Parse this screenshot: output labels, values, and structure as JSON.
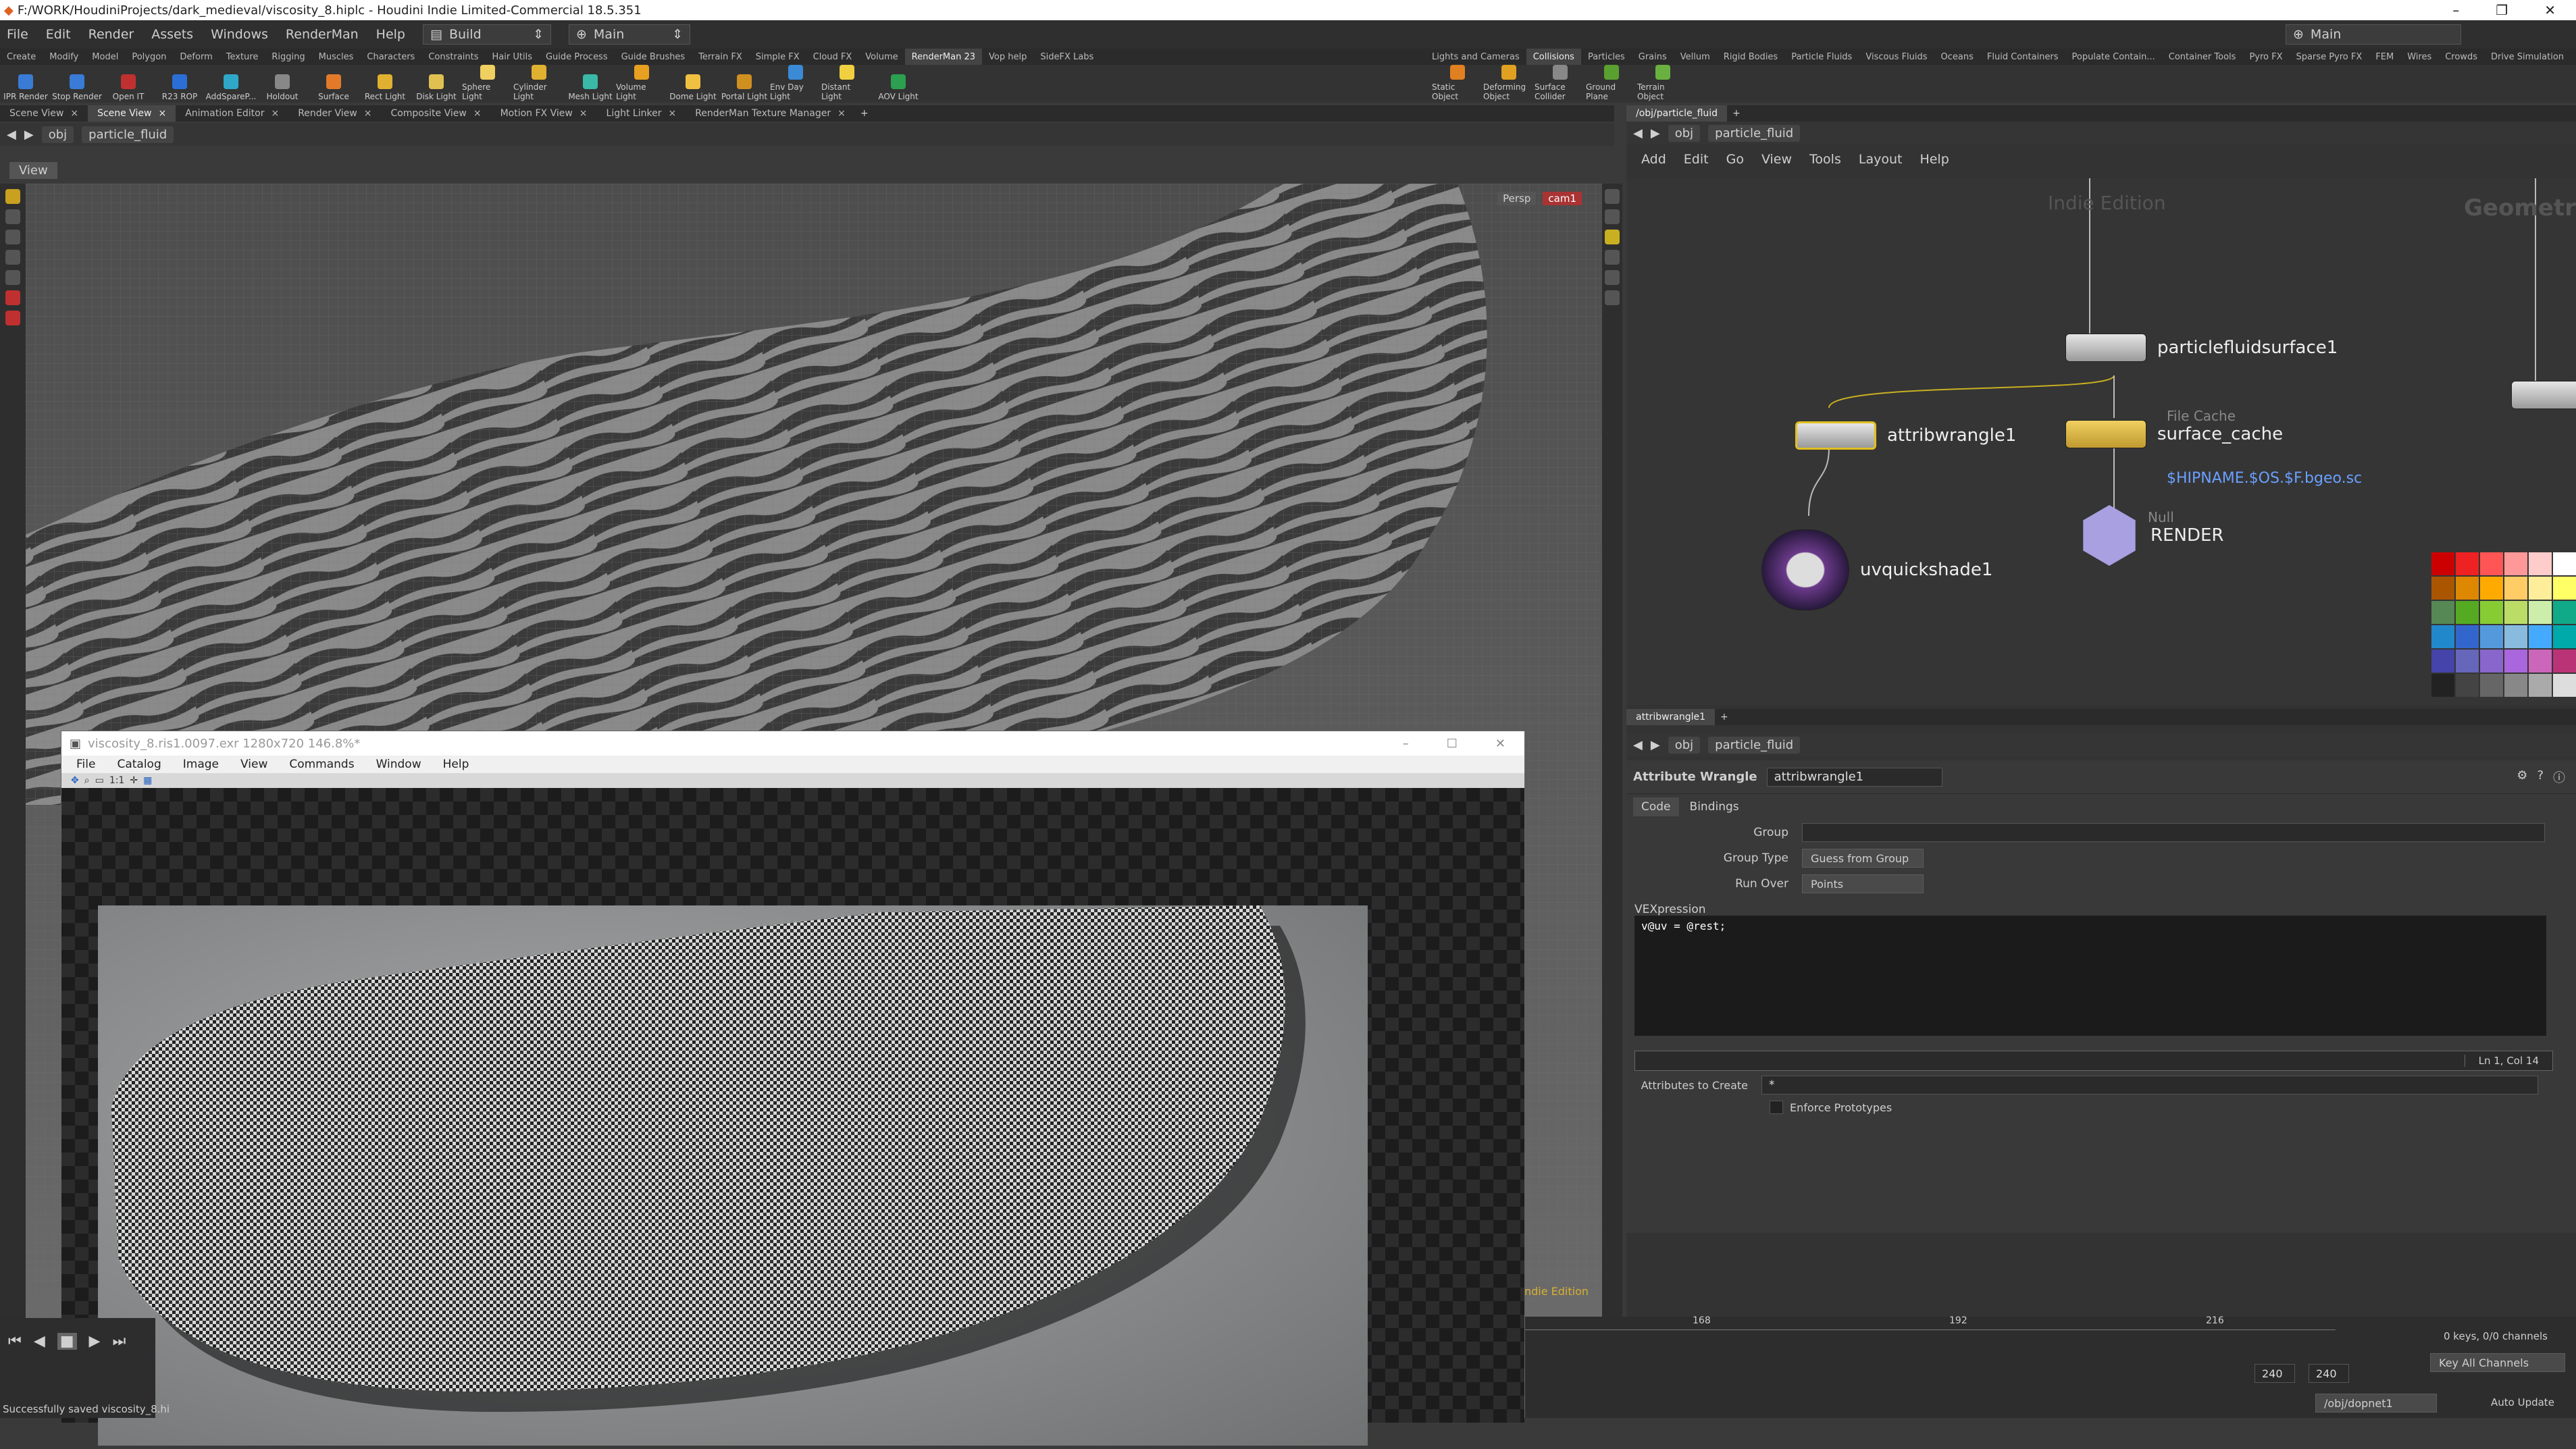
{
  "window": {
    "title": "F:/WORK/HoudiniProjects/dark_medieval/viscosity_8.hiplc - Houdini Indie Limited-Commercial 18.5.351",
    "controls": [
      "–",
      "❐",
      "✕"
    ]
  },
  "menubar": {
    "items": [
      "File",
      "Edit",
      "Render",
      "Assets",
      "Windows",
      "RenderMan",
      "Help"
    ],
    "desktop": "Build",
    "context": "Main",
    "right_context": "Main"
  },
  "shelf_tabs_left": [
    "Create",
    "Modify",
    "Model",
    "Polygon",
    "Deform",
    "Texture",
    "Rigging",
    "Muscles",
    "Characters",
    "Constraints",
    "Hair Utils",
    "Guide Process",
    "Guide Brushes",
    "Terrain FX",
    "Simple FX",
    "Cloud FX",
    "Volume",
    "RenderMan 23",
    "Vop help",
    "SideFX Labs"
  ],
  "shelf_tabs_left_active": "RenderMan 23",
  "shelf_tabs_right": [
    "Lights and Cameras",
    "Collisions",
    "Particles",
    "Grains",
    "Vellum",
    "Rigid Bodies",
    "Particle Fluids",
    "Viscous Fluids",
    "Oceans",
    "Fluid Containers",
    "Populate Contain...",
    "Container Tools",
    "Pyro FX",
    "Sparse Pyro FX",
    "FEM",
    "Wires",
    "Crowds",
    "Drive Simulation"
  ],
  "shelf_tabs_right_active": "Collisions",
  "tools_left": [
    {
      "label": "IPR Render",
      "color": "#3a7bd5"
    },
    {
      "label": "Stop Render",
      "color": "#3a7bd5"
    },
    {
      "label": "Open IT",
      "color": "#c03030"
    },
    {
      "label": "R23 ROP",
      "color": "#2b6fd6"
    },
    {
      "label": "AddSpareP...",
      "color": "#2fa7c9"
    },
    {
      "label": "Holdout",
      "color": "#888"
    },
    {
      "label": "Surface",
      "color": "#e27a2a"
    },
    {
      "label": "Rect Light",
      "color": "#e0b030"
    },
    {
      "label": "Disk Light",
      "color": "#e0c050"
    },
    {
      "label": "Sphere Light",
      "color": "#f0d060"
    },
    {
      "label": "Cylinder Light",
      "color": "#e0b030"
    },
    {
      "label": "Mesh Light",
      "color": "#3ab8a8"
    },
    {
      "label": "Volume Light",
      "color": "#e8a020"
    },
    {
      "label": "Dome Light",
      "color": "#f0c040"
    },
    {
      "label": "Portal Light",
      "color": "#d09020"
    },
    {
      "label": "Env Day Light",
      "color": "#3a8ad5"
    },
    {
      "label": "Distant Light",
      "color": "#f0d040"
    },
    {
      "label": "AOV Light",
      "color": "#2aa050"
    }
  ],
  "tools_right": [
    {
      "label": "Static Object",
      "color": "#e08020"
    },
    {
      "label": "Deforming Object",
      "color": "#e0a020"
    },
    {
      "label": "Surface Collider",
      "color": "#888"
    },
    {
      "label": "Ground Plane",
      "color": "#5aa030"
    },
    {
      "label": "Terrain Object",
      "color": "#6ab040"
    }
  ],
  "left_pane_tabs": [
    "Scene View",
    "Scene View",
    "Animation Editor",
    "Render View",
    "Composite View",
    "Motion FX View",
    "Light Linker",
    "RenderMan Texture Manager"
  ],
  "left_pane_active": 1,
  "left_path": {
    "context": "obj",
    "node": "particle_fluid"
  },
  "viewport": {
    "label": "View",
    "persp": "Persp",
    "camera": "cam1",
    "watermark": "Indie Edition"
  },
  "mplay": {
    "title": "viscosity_8.ris1.0097.exr 1280x720 146.8%*",
    "menu": [
      "File",
      "Catalog",
      "Image",
      "View",
      "Commands",
      "Window",
      "Help"
    ],
    "zoom_label": "1:1"
  },
  "right_pane": {
    "tab": "/obj/particle_fluid",
    "path": {
      "context": "obj",
      "node": "particle_fluid"
    },
    "menu": [
      "Add",
      "Edit",
      "Go",
      "View",
      "Tools",
      "Layout",
      "Help"
    ],
    "watermark": "Indie Edition",
    "context_label": "Geometry"
  },
  "nodes": {
    "pfs": {
      "name": "particlefluidsurface1"
    },
    "wrangle": {
      "name": "attribwrangle1"
    },
    "cache": {
      "type": "File Cache",
      "name": "surface_cache",
      "path": "$HIPNAME.$OS.$F.bgeo.sc"
    },
    "uv": {
      "name": "uvquickshade1"
    },
    "render": {
      "type": "Null",
      "name": "RENDER"
    }
  },
  "params_tab": "attribwrangle1",
  "params": {
    "path": {
      "context": "obj",
      "node": "particle_fluid"
    },
    "node_type": "Attribute Wrangle",
    "node_name": "attribwrangle1",
    "tabs": [
      "Code",
      "Bindings"
    ],
    "group_label": "Group",
    "group_value": "",
    "group_type_label": "Group Type",
    "group_type_value": "Guess from Group",
    "run_over_label": "Run Over",
    "run_over_value": "Points",
    "vex_label": "VEXpression",
    "vex_code": "v@uv = @rest;",
    "cursor": "Ln 1, Col 14",
    "attrs_label": "Attributes to Create",
    "attrs_value": "*",
    "enforce_label": "Enforce Prototypes",
    "enforce_checked": false
  },
  "timeline": {
    "ticks": [
      "168",
      "192",
      "216"
    ],
    "start": "240",
    "end": "240",
    "keys": "0 keys, 0/0 channels",
    "key_all": "Key All Channels",
    "path": "/obj/dopnet1",
    "update": "Auto Update"
  },
  "status": "Successfully saved viscosity_8.hi"
}
